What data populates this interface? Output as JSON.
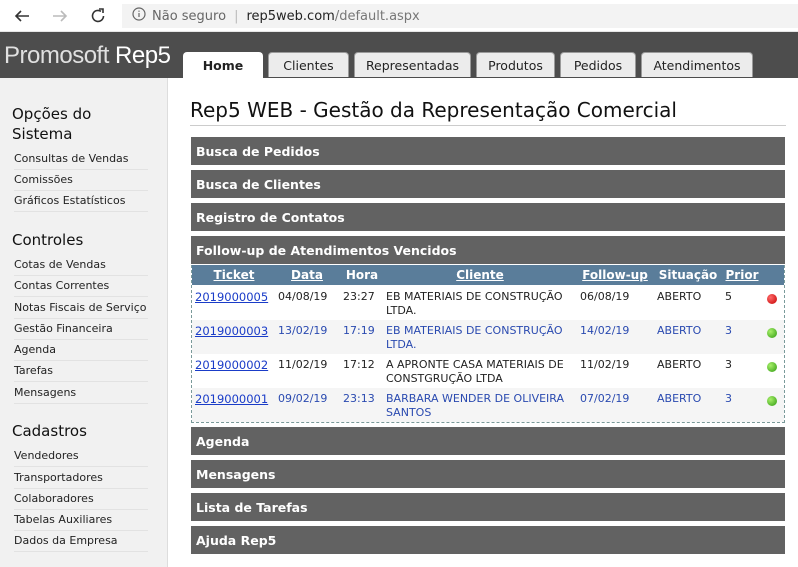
{
  "browser": {
    "security_label": "Não seguro",
    "url_host": "rep5web.com",
    "url_path": "/default.aspx"
  },
  "app": {
    "logo_light": "Promosoft",
    "logo_bold": "Rep5",
    "tabs": [
      {
        "label": "Home",
        "active": true
      },
      {
        "label": "Clientes"
      },
      {
        "label": "Representadas"
      },
      {
        "label": "Produtos"
      },
      {
        "label": "Pedidos"
      },
      {
        "label": "Atendimentos"
      }
    ]
  },
  "sidebar": {
    "sections": [
      {
        "title_line1": "Opções do",
        "title_line2": "Sistema",
        "items": [
          "Consultas de Vendas",
          "Comissões",
          "Gráficos Estatísticos"
        ]
      },
      {
        "title": "Controles",
        "items": [
          "Cotas de Vendas",
          "Contas Correntes",
          "Notas Fiscais de Serviço",
          "Gestão Financeira",
          "Agenda",
          "Tarefas",
          "Mensagens"
        ]
      },
      {
        "title": "Cadastros",
        "items": [
          "Vendedores",
          "Transportadores",
          "Colaboradores",
          "Tabelas Auxiliares",
          "Dados da Empresa"
        ]
      }
    ]
  },
  "main": {
    "title": "Rep5 WEB - Gestão da Representação Comercial",
    "sections": [
      "Busca de Pedidos",
      "Busca de Clientes",
      "Registro de Contatos",
      "Follow-up de Atendimentos Vencidos",
      "Agenda",
      "Mensagens",
      "Lista de Tarefas",
      "Ajuda Rep5"
    ],
    "table": {
      "headers": [
        "Ticket",
        "Data",
        "Hora",
        "Cliente",
        "Follow-up",
        "Situação",
        "Prior"
      ],
      "rows": [
        {
          "ticket": "2019000005",
          "data": "04/08/19",
          "hora": "23:27",
          "cliente1": "EB MATERIAIS DE CONSTRUÇÃO",
          "cliente2": "LTDA.",
          "followup": "06/08/19",
          "situacao": "ABERTO",
          "prior": "5",
          "status_color": "#d40000"
        },
        {
          "ticket": "2019000003",
          "data": "13/02/19",
          "hora": "17:19",
          "cliente1": "EB MATERIAIS DE CONSTRUÇÃO",
          "cliente2": "LTDA.",
          "followup": "14/02/19",
          "situacao": "ABERTO",
          "prior": "3",
          "status_color": "#3aa815"
        },
        {
          "ticket": "2019000002",
          "data": "11/02/19",
          "hora": "17:12",
          "cliente1": "A APRONTE CASA MATERIAIS DE",
          "cliente2": "CONSTGRUÇÃO LTDA",
          "followup": "11/02/19",
          "situacao": "ABERTO",
          "prior": "3",
          "status_color": "#3aa815"
        },
        {
          "ticket": "2019000001",
          "data": "09/02/19",
          "hora": "23:13",
          "cliente1": "BARBARA WENDER DE OLIVEIRA",
          "cliente2": "SANTOS",
          "followup": "07/02/19",
          "situacao": "ABERTO",
          "prior": "3",
          "status_color": "#3aa815"
        }
      ]
    }
  },
  "colors": {
    "header_bg": "#4d4d4d",
    "section_bar": "#626262",
    "table_header": "#5a7d9a",
    "link": "#1a3cc8"
  }
}
